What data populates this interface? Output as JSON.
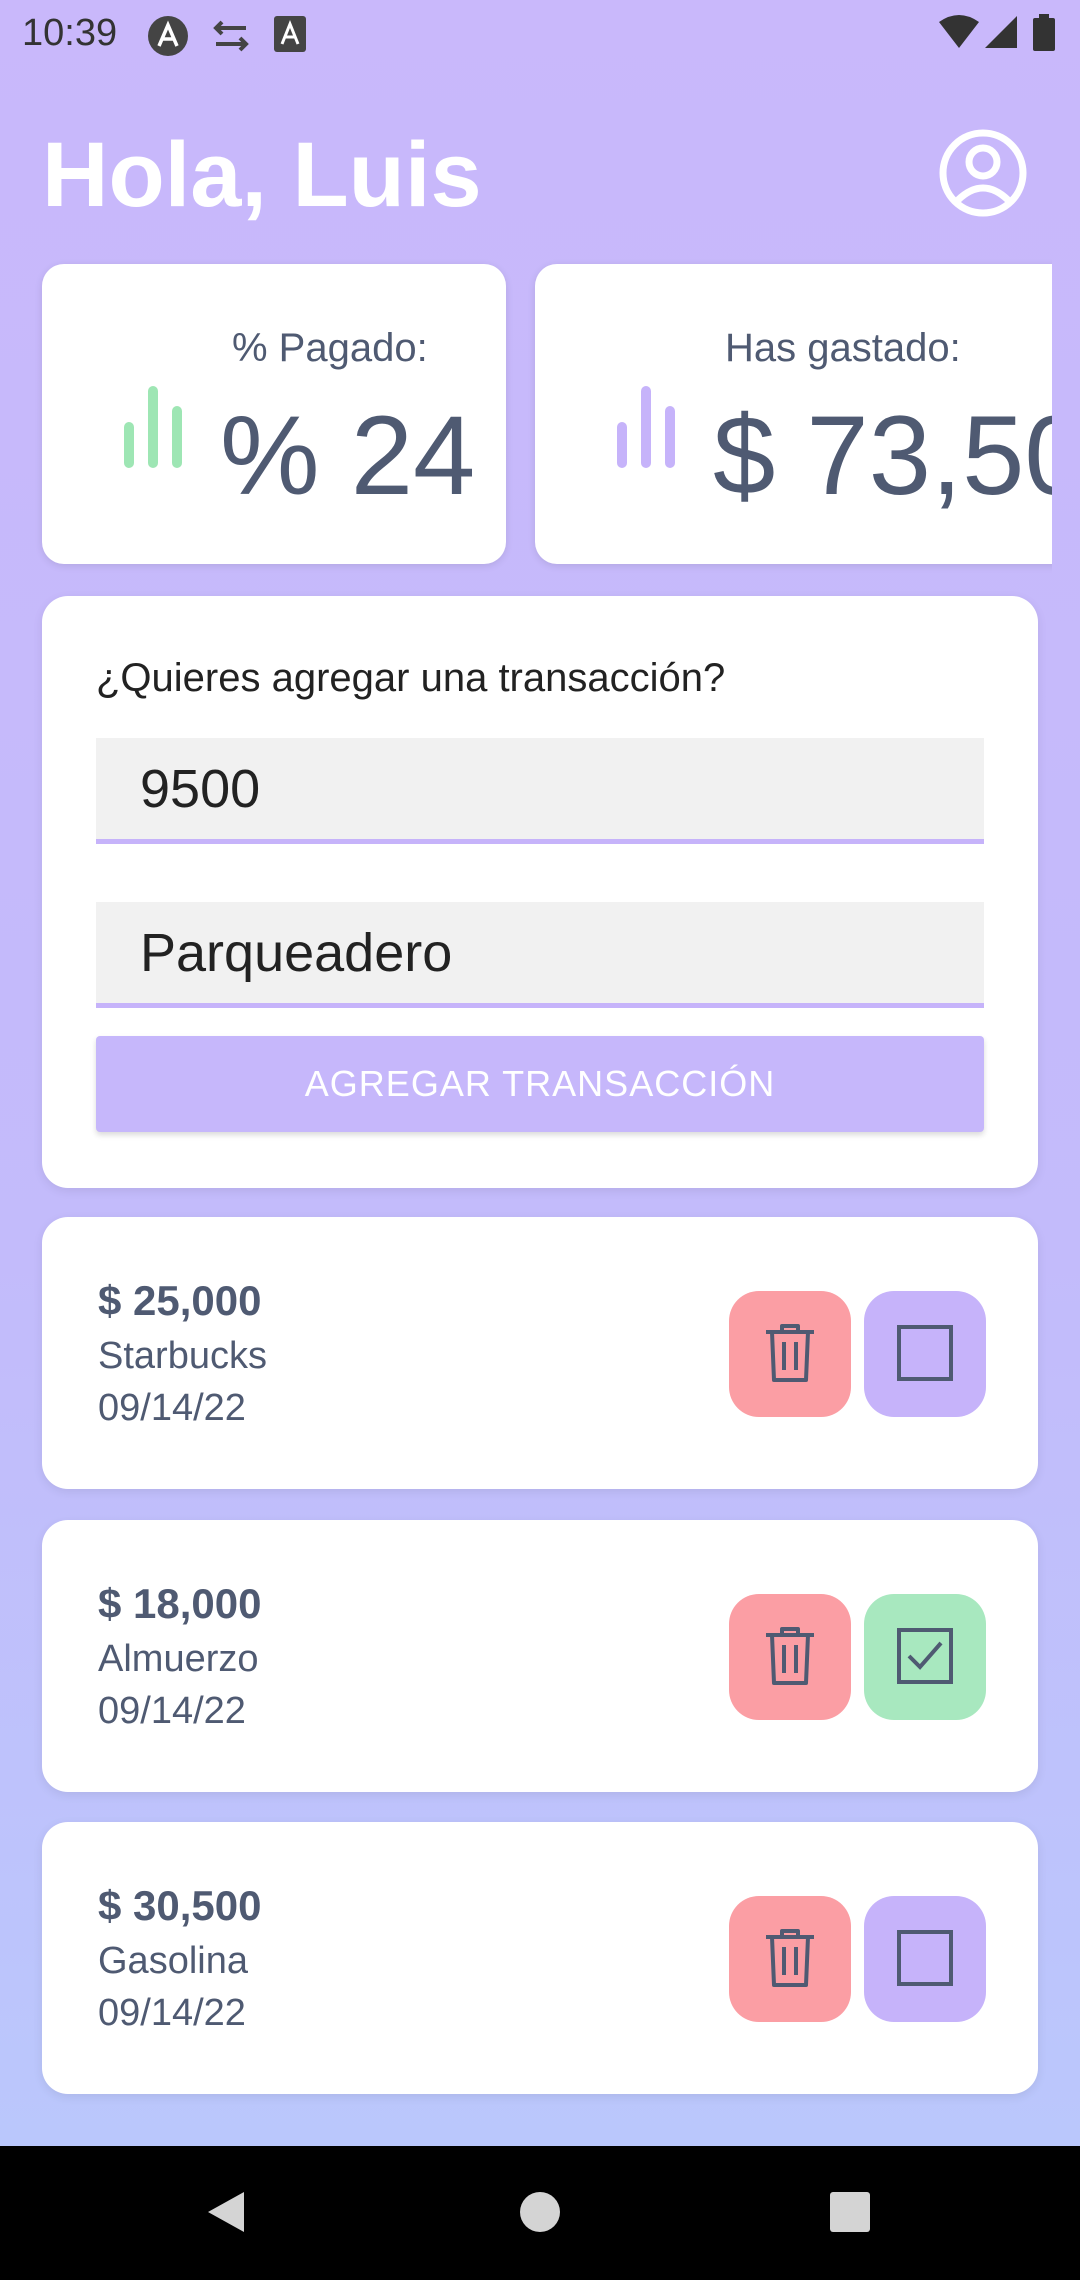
{
  "status_bar": {
    "time": "10:39",
    "left_icons": [
      "app-badge-icon",
      "network-icon",
      "accessibility-a-icon"
    ],
    "right_icons": [
      "wifi-icon",
      "signal-icon",
      "battery-icon"
    ]
  },
  "header": {
    "greeting": "Hola, Luis",
    "profile_icon": "account-circle-icon"
  },
  "stats": [
    {
      "label": "% Pagado:",
      "value": "% 24",
      "icon": "bar-chart-icon",
      "icon_color": "#9ee6b4"
    },
    {
      "label": "Has gastado:",
      "value": "$ 73,50",
      "icon": "bar-chart-icon",
      "icon_color": "#c6b3fa"
    }
  ],
  "add_form": {
    "question": "¿Quieres agregar una transacción?",
    "amount_value": "9500",
    "description_value": "Parqueadero",
    "button_label": "AGREGAR TRANSACCIÓN"
  },
  "transactions": [
    {
      "amount": "$ 25,000",
      "name": "Starbucks",
      "date": "09/14/22",
      "paid": false
    },
    {
      "amount": "$ 18,000",
      "name": "Almuerzo",
      "date": "09/14/22",
      "paid": true
    },
    {
      "amount": "$ 30,500",
      "name": "Gasolina",
      "date": "09/14/22",
      "paid": false
    }
  ],
  "colors": {
    "accent": "#c6b3fa",
    "paid": "#a8e8bf",
    "delete": "#fb9ea4",
    "text": "#4f5a72"
  },
  "nav_bar": [
    "back-icon",
    "home-icon",
    "recents-icon"
  ]
}
